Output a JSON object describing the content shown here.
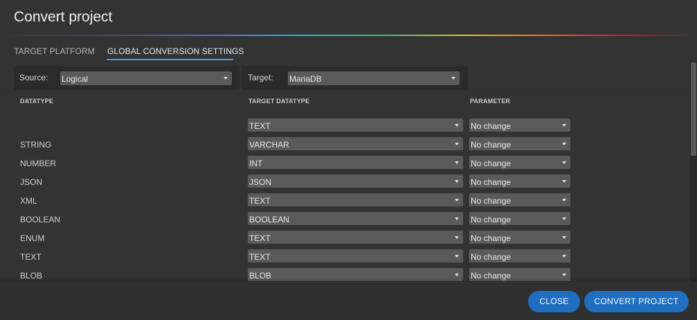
{
  "dialog": {
    "title": "Convert project"
  },
  "tabs": [
    {
      "label": "TARGET PLATFORM",
      "active": false
    },
    {
      "label": "GLOBAL CONVERSION SETTINGS",
      "active": true
    }
  ],
  "source": {
    "label": "Source:",
    "value": "Logical"
  },
  "target": {
    "label": "Target:",
    "value": "MariaDB"
  },
  "columns": {
    "datatype": "DATATYPE",
    "target_datatype": "TARGET DATATYPE",
    "parameter": "PARAMETER"
  },
  "rows": [
    {
      "datatype": "",
      "target": "TEXT",
      "parameter": "No change"
    },
    {
      "datatype": "STRING",
      "target": "VARCHAR",
      "parameter": "No change"
    },
    {
      "datatype": "NUMBER",
      "target": "INT",
      "parameter": "No change"
    },
    {
      "datatype": "JSON",
      "target": "JSON",
      "parameter": "No change"
    },
    {
      "datatype": "XML",
      "target": "TEXT",
      "parameter": "No change"
    },
    {
      "datatype": "BOOLEAN",
      "target": "BOOLEAN",
      "parameter": "No change"
    },
    {
      "datatype": "ENUM",
      "target": "TEXT",
      "parameter": "No change"
    },
    {
      "datatype": "TEXT",
      "target": "TEXT",
      "parameter": "No change"
    },
    {
      "datatype": "BLOB",
      "target": "BLOB",
      "parameter": "No change"
    }
  ],
  "footer": {
    "close_label": "CLOSE",
    "convert_label": "CONVERT PROJECT"
  },
  "colors": {
    "accent": "#1e6fbf",
    "tab_underline": "#4aa0e6",
    "background": "#333333"
  }
}
